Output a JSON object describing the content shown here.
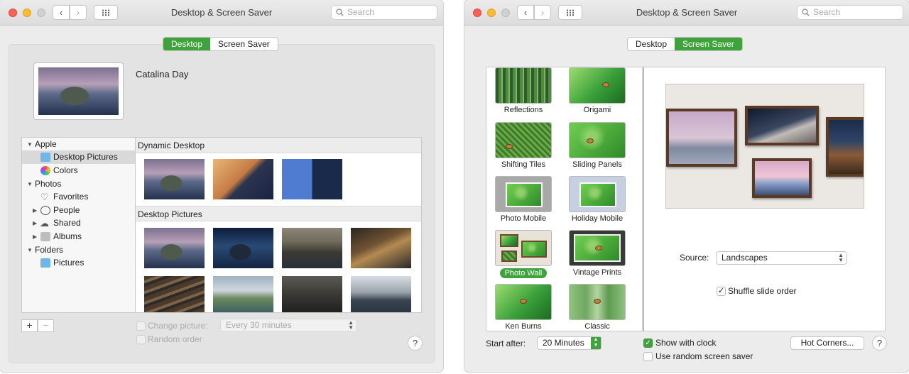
{
  "left_window": {
    "title": "Desktop & Screen Saver",
    "search_placeholder": "Search",
    "tabs": [
      "Desktop",
      "Screen Saver"
    ],
    "active_tab": "Desktop",
    "current_wallpaper": "Catalina Day",
    "sidebar": {
      "items": [
        {
          "label": "Apple",
          "type": "group",
          "expanded": true
        },
        {
          "label": "Desktop Pictures",
          "icon": "folder-icon",
          "selected": true
        },
        {
          "label": "Colors",
          "icon": "color-wheel-icon"
        },
        {
          "label": "Photos",
          "type": "group",
          "expanded": true
        },
        {
          "label": "Favorites",
          "icon": "heart-icon"
        },
        {
          "label": "People",
          "icon": "person-icon",
          "collapsed": true
        },
        {
          "label": "Shared",
          "icon": "cloud-icon",
          "collapsed": true
        },
        {
          "label": "Albums",
          "icon": "folder-icon",
          "collapsed": true
        },
        {
          "label": "Folders",
          "type": "group",
          "expanded": true
        },
        {
          "label": "Pictures",
          "icon": "folder-icon"
        }
      ]
    },
    "gallery": {
      "sections": [
        {
          "title": "Dynamic Desktop",
          "thumb_count": 3
        },
        {
          "title": "Desktop Pictures",
          "thumb_count": 8
        }
      ]
    },
    "add_label": "+",
    "remove_label": "−",
    "change_picture_label": "Change picture:",
    "interval_value": "Every 30 minutes",
    "random_order_label": "Random order",
    "help_label": "?"
  },
  "right_window": {
    "title": "Desktop & Screen Saver",
    "search_placeholder": "Search",
    "tabs": [
      "Desktop",
      "Screen Saver"
    ],
    "active_tab": "Screen Saver",
    "screen_savers": [
      {
        "label": "Reflections"
      },
      {
        "label": "Origami"
      },
      {
        "label": "Shifting Tiles"
      },
      {
        "label": "Sliding Panels"
      },
      {
        "label": "Photo Mobile"
      },
      {
        "label": "Holiday Mobile"
      },
      {
        "label": "Photo Wall",
        "selected": true
      },
      {
        "label": "Vintage Prints"
      },
      {
        "label": "Ken Burns"
      },
      {
        "label": "Classic"
      }
    ],
    "source_label": "Source:",
    "source_value": "Landscapes",
    "shuffle_label": "Shuffle slide order",
    "shuffle_checked": true,
    "start_after_label": "Start after:",
    "start_after_value": "20 Minutes",
    "show_clock_label": "Show with clock",
    "show_clock_checked": true,
    "random_saver_label": "Use random screen saver",
    "random_saver_checked": false,
    "hot_corners_label": "Hot Corners...",
    "help_label": "?"
  },
  "colors": {
    "accent": "#3fa33b",
    "close": "#fe5f57",
    "minimize": "#febc2e"
  }
}
